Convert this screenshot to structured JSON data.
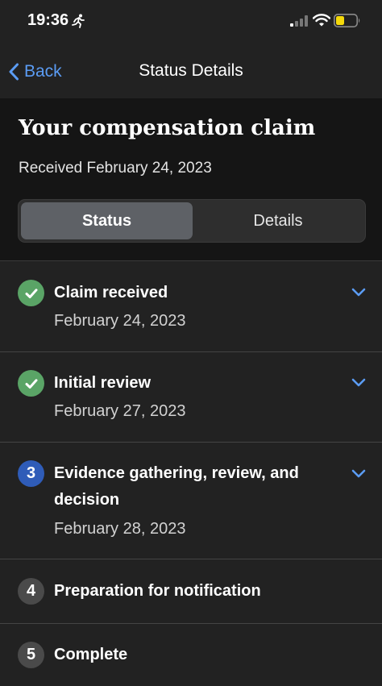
{
  "status_bar": {
    "time": "19:36",
    "activity_icon": "running-figure-icon",
    "signal_icon": "cellular-signal-icon",
    "wifi_icon": "wifi-icon",
    "battery_icon": "battery-low-icon",
    "battery_color": "#f5d90a"
  },
  "nav": {
    "back_label": "Back",
    "title": "Status Details",
    "accent_color": "#5b9cf4"
  },
  "claim": {
    "title": "Your compensation claim",
    "received": "Received February 24, 2023"
  },
  "tabs": [
    {
      "label": "Status",
      "selected": true
    },
    {
      "label": "Details",
      "selected": false
    }
  ],
  "steps": [
    {
      "marker": "check-icon",
      "state": "complete",
      "title": "Claim received",
      "date": "February 24, 2023",
      "expandable": true
    },
    {
      "marker": "check-icon",
      "state": "complete",
      "title": "Initial review",
      "date": "February 27, 2023",
      "expandable": true
    },
    {
      "marker": "3",
      "state": "current",
      "title": "Evidence gathering, review, and decision",
      "date": "February 28, 2023",
      "expandable": true
    },
    {
      "marker": "4",
      "state": "upcoming",
      "title": "Preparation for notification",
      "date": "",
      "expandable": false
    },
    {
      "marker": "5",
      "state": "upcoming",
      "title": "Complete",
      "date": "",
      "expandable": false
    }
  ],
  "colors": {
    "complete": "#5aa466",
    "current": "#2f5cb8",
    "upcoming": "#4a4a4a"
  }
}
